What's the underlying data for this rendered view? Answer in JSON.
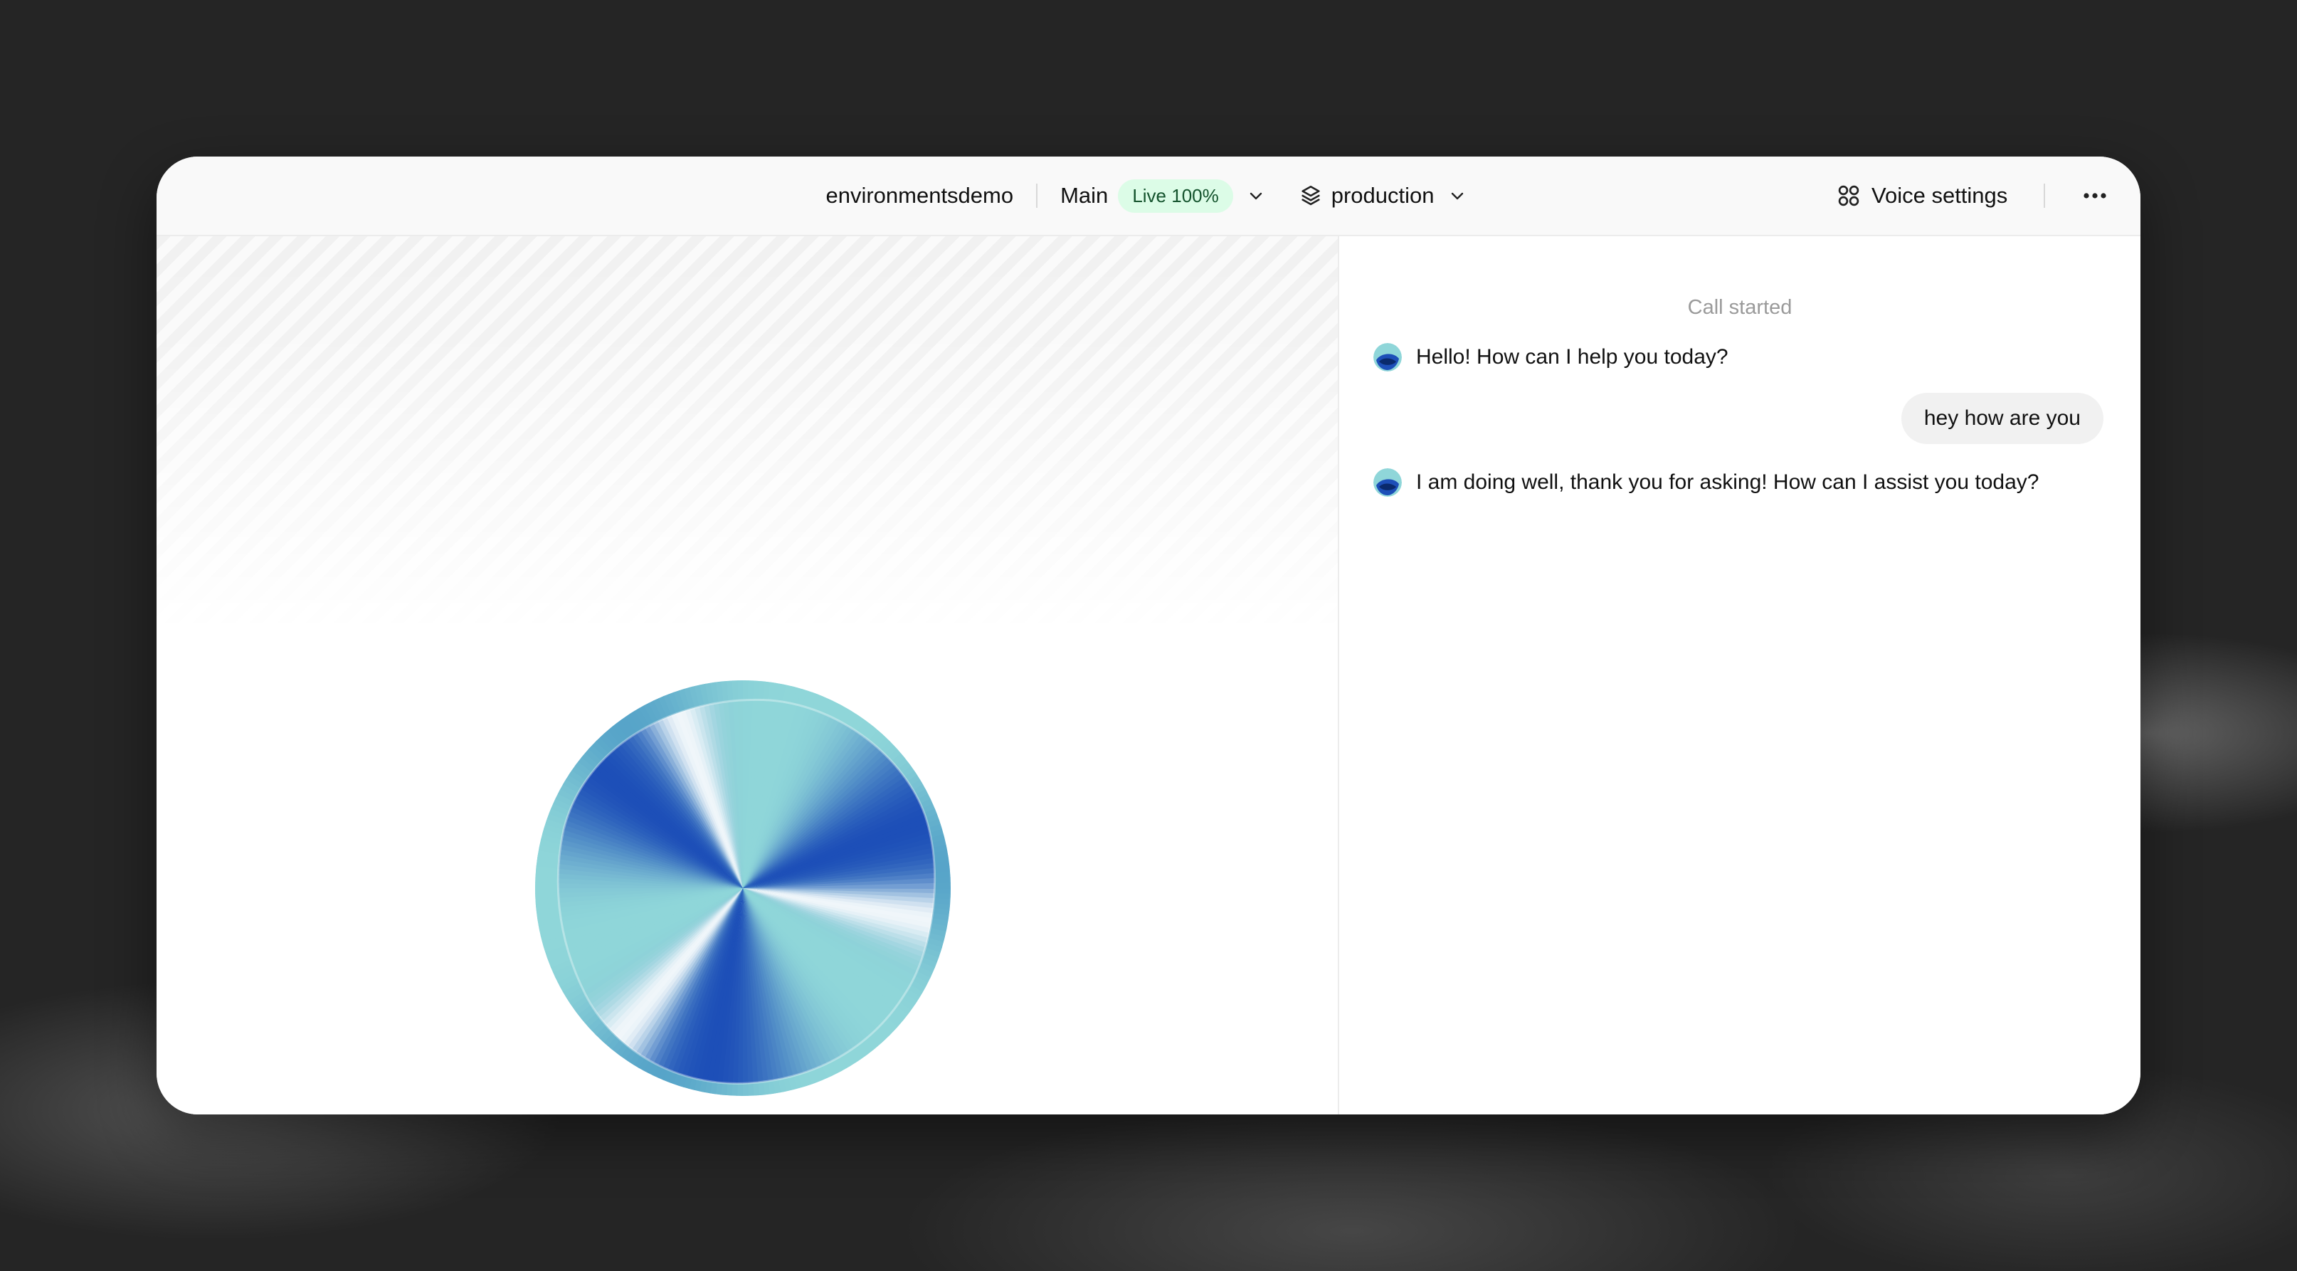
{
  "topbar": {
    "agent_name": "environmentsdemo",
    "branch": "Main",
    "live_badge": "Live 100%",
    "environment": "production",
    "voice_settings_label": "Voice settings"
  },
  "chat": {
    "status": "Call started",
    "messages": [
      {
        "role": "agent",
        "text": "Hello! How can I help you today?"
      },
      {
        "role": "user",
        "text": "hey how are you"
      },
      {
        "role": "agent",
        "text": "I am doing well, thank you for asking! How can I assist you today?"
      }
    ]
  },
  "icons": {
    "branch_dropdown": "chevron-down-icon",
    "environment": "layers-icon",
    "environment_dropdown": "chevron-down-icon",
    "voice_settings": "grid-icon",
    "more": "more-horizontal-icon",
    "end_call": "phone-off-icon",
    "agent_avatar": "orb-avatar-icon"
  },
  "colors": {
    "live_badge_bg": "#dcfce7",
    "live_badge_text": "#14532d",
    "end_call": "#e0463c",
    "orb_dark_blue": "#1d4fb8",
    "orb_light_teal": "#8fd6d9"
  }
}
